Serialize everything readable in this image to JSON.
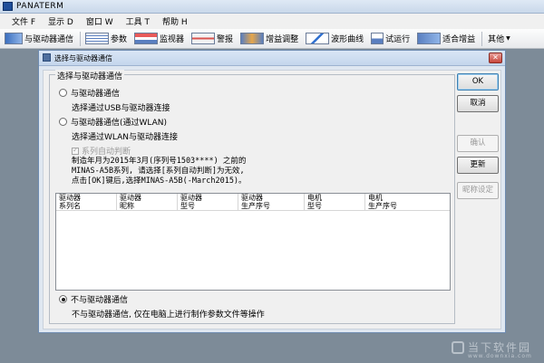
{
  "window": {
    "title": "PANATERM"
  },
  "menu": [
    {
      "label": "文件 F"
    },
    {
      "label": "显示 D"
    },
    {
      "label": "窗口 W"
    },
    {
      "label": "工具 T"
    },
    {
      "label": "帮助 H"
    }
  ],
  "toolbar": {
    "items": [
      {
        "label": "与驱动器通信",
        "icon": "communication-icon"
      },
      {
        "label": "参数",
        "icon": "parameter-icon"
      },
      {
        "label": "监视器",
        "icon": "monitor-icon"
      },
      {
        "label": "警报",
        "icon": "alarm-icon"
      },
      {
        "label": "增益调整",
        "icon": "gain-adjust-icon"
      },
      {
        "label": "波形曲线",
        "icon": "waveform-icon"
      },
      {
        "label": "试运行",
        "icon": "trial-run-icon"
      },
      {
        "label": "适合增益",
        "icon": "fit-gain-icon"
      }
    ],
    "more_label": "其他"
  },
  "dialog": {
    "title": "选择与驱动器通信",
    "group_label": "选择与驱动器通信",
    "option_usb": {
      "label": "与驱动器通信",
      "description": "选择通过USB与驱动器连接"
    },
    "option_wlan": {
      "label": "与驱动器通信(通过WLAN)",
      "description": "选择通过WLAN与驱动器连接"
    },
    "auto_detect_label": "系列自动判断",
    "note_lines": [
      "制造年月为2015年3月(序列号1503****) 之前的",
      "MINAS-A5B系列, 请选择[系列自动判断]为无效,",
      "点击[OK]键后,选择MINAS-A5B(-March2015)。"
    ],
    "table_columns": [
      {
        "line1": "驱动器",
        "line2": "系列名"
      },
      {
        "line1": "驱动器",
        "line2": "昵称"
      },
      {
        "line1": "驱动器",
        "line2": "型号"
      },
      {
        "line1": "驱动器",
        "line2": "生产序号"
      },
      {
        "line1": "电机",
        "line2": "型号"
      },
      {
        "line1": "电机",
        "line2": "生产序号"
      }
    ],
    "option_offline": {
      "label": "不与驱动器通信",
      "description": "不与驱动器通信, 仅在电脑上进行制作参数文件等操作"
    },
    "buttons": {
      "ok": "OK",
      "cancel": "取消",
      "confirm": "确认",
      "update": "更新",
      "nickname": "昵称设定"
    }
  },
  "watermark": {
    "text": "当下软件园",
    "sub": "www.downxia.com"
  },
  "colors": {
    "desktop": "#7d8b98",
    "dialog_frame": "#dfe7f1",
    "accent": "#3c7fb1"
  }
}
